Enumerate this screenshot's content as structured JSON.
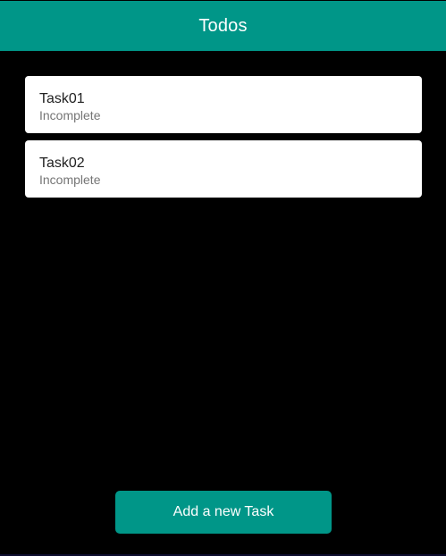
{
  "app_bar": {
    "title": "Todos",
    "color": "#009688"
  },
  "tasks": [
    {
      "title": "Task01",
      "status": "Incomplete"
    },
    {
      "title": "Task02",
      "status": "Incomplete"
    }
  ],
  "add_button": {
    "label": "Add a new Task",
    "color": "#009688"
  },
  "theme": {
    "background": "#000000",
    "card": "#ffffff"
  }
}
